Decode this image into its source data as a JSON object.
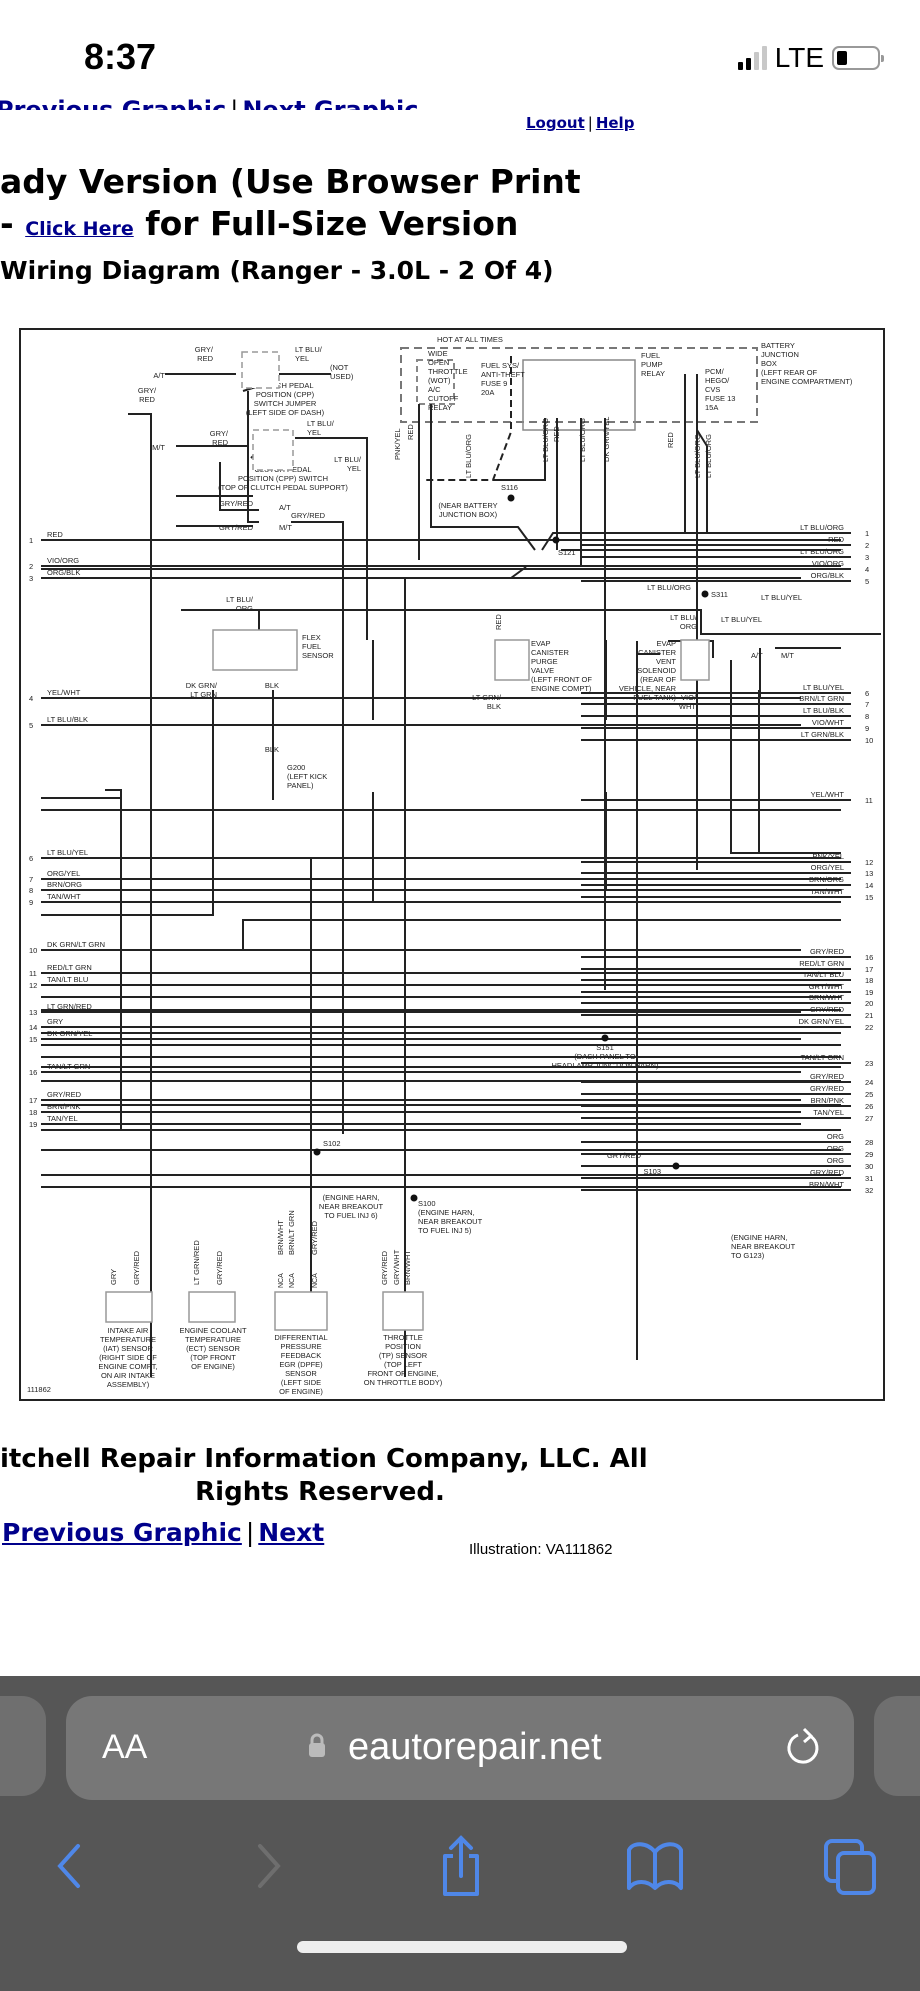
{
  "status_bar": {
    "time": "8:37",
    "network": "LTE",
    "signal_bars_active": 2,
    "signal_bars_total": 4,
    "battery_level": 0.2
  },
  "page": {
    "nav_top": {
      "previous": "Previous Graphic",
      "separator": "|",
      "next": "Next Graphic"
    },
    "top_links": {
      "logout": "Logout",
      "separator": "|",
      "help": "Help"
    },
    "heading_line1": "ady Version (Use Browser Print",
    "heading_line2_prefix": "- ",
    "heading_link": "Click Here",
    "heading_line2_suffix": " for Full-Size Version",
    "subheading": "Wiring Diagram (Ranger - 3.0L - 2 Of 4)",
    "copyright_line1": "itchell Repair Information Company, LLC.  All",
    "copyright_line2": "Rights Reserved.",
    "nav_bottom": {
      "previous": "Previous Graphic",
      "separator": "|",
      "next": "Next"
    },
    "illustration": "Illustration: VA111862"
  },
  "diagram": {
    "id_label": "111862",
    "hot_label": "HOT AT ALL TIMES",
    "components": {
      "cpp_jumper": [
        "CLUTCH PEDAL",
        "POSITION (CPP)",
        "SWITCH JUMPER",
        "(LEFT SIDE OF DASH)"
      ],
      "cpp_switch": [
        "CLUTCH PEDAL",
        "POSITION (CPP) SWITCH",
        "(TOP OF CLUTCH PEDAL SUPPORT)"
      ],
      "wot_relay": [
        "WIDE",
        "OPEN",
        "THROTTLE",
        "(WOT)",
        "A/C",
        "CUTOFF",
        "RELAY"
      ],
      "fuse9": [
        "FUEL SYS/",
        "ANTI-THEFT",
        "FUSE 9",
        "20A"
      ],
      "fuel_pump_relay": [
        "FUEL",
        "PUMP",
        "RELAY"
      ],
      "fuse13": [
        "PCM/",
        "HEGO/",
        "CVS",
        "FUSE 13",
        "15A"
      ],
      "bjb": [
        "BATTERY",
        "JUNCTION",
        "BOX",
        "(LEFT REAR OF",
        "ENGINE COMPARTMENT)"
      ],
      "flex_fuel": [
        "FLEX",
        "FUEL",
        "SENSOR"
      ],
      "evap_purge": [
        "EVAP",
        "CANISTER",
        "PURGE",
        "VALVE",
        "(LEFT FRONT OF",
        "ENGINE COMPT)"
      ],
      "evap_vent": [
        "EVAP",
        "CANISTER",
        "VENT",
        "SOLENOID",
        "(REAR OF",
        "VEHICLE, NEAR",
        "FUEL TANK)"
      ],
      "g200": [
        "G200",
        "(LEFT KICK",
        "PANEL)"
      ],
      "s116": "S116",
      "s121": "S121",
      "s121_note": [
        "(NEAR BATTERY",
        "JUNCTION BOX)"
      ],
      "s311": "S311",
      "s151": [
        "S151",
        "(DASH PANEL TO",
        "HEADLAMP JUNCTION HARN)"
      ],
      "s102": "S102",
      "s102_note": [
        "(ENGINE HARN,",
        "NEAR BREAKOUT",
        "TO FUEL INJ 6)"
      ],
      "s100": [
        "S100",
        "(ENGINE HARN,",
        "NEAR BREAKOUT",
        "TO FUEL INJ 5)"
      ],
      "s103": "S103",
      "s103_note": [
        "(ENGINE HARN,",
        "NEAR BREAKOUT",
        "TO G123)"
      ],
      "iat": [
        "INTAKE AIR",
        "TEMPERATURE",
        "(IAT) SENSOR",
        "(RIGHT SIDE OF",
        "ENGINE COMPT,",
        "ON AIR INTAKE",
        "ASSEMBLY)"
      ],
      "ect": [
        "ENGINE COOLANT",
        "TEMPERATURE",
        "(ECT) SENSOR",
        "(TOP FRONT",
        "OF ENGINE)"
      ],
      "dpfe": [
        "DIFFERENTIAL",
        "PRESSURE",
        "FEEDBACK",
        "EGR (DPFE)",
        "SENSOR",
        "(LEFT SIDE",
        "OF ENGINE)"
      ],
      "tp": [
        "THROTTLE",
        "POSITION",
        "(TP) SENSOR",
        "(TOP LEFT",
        "FRONT OF ENGINE,",
        "ON THROTTLE BODY)"
      ]
    },
    "left_pins": [
      {
        "n": "1",
        "wire": "RED"
      },
      {
        "n": "2",
        "wire": "VIO/ORG"
      },
      {
        "n": "3",
        "wire": "ORG/BLK"
      },
      {
        "n": "4",
        "wire": "YEL/WHT"
      },
      {
        "n": "5",
        "wire": "LT BLU/BLK"
      },
      {
        "n": "6",
        "wire": "LT BLU/YEL"
      },
      {
        "n": "7",
        "wire": "ORG/YEL"
      },
      {
        "n": "8",
        "wire": "BRN/ORG"
      },
      {
        "n": "9",
        "wire": "TAN/WHT"
      },
      {
        "n": "10",
        "wire": "DK GRN/LT GRN"
      },
      {
        "n": "11",
        "wire": "RED/LT GRN"
      },
      {
        "n": "12",
        "wire": "TAN/LT BLU"
      },
      {
        "n": "13",
        "wire": "LT GRN/RED"
      },
      {
        "n": "14",
        "wire": "GRY"
      },
      {
        "n": "15",
        "wire": "DK GRN/YEL"
      },
      {
        "n": "16",
        "wire": "TAN/LT GRN"
      },
      {
        "n": "17",
        "wire": "GRY/RED"
      },
      {
        "n": "18",
        "wire": "BRN/PNK"
      },
      {
        "n": "19",
        "wire": "TAN/YEL"
      }
    ],
    "right_pins": [
      {
        "n": "1",
        "wire": "LT BLU/ORG"
      },
      {
        "n": "2",
        "wire": "RED"
      },
      {
        "n": "3",
        "wire": "LT BLU/ORG"
      },
      {
        "n": "4",
        "wire": "VIO/ORG"
      },
      {
        "n": "5",
        "wire": "ORG/BLK"
      },
      {
        "n": "6",
        "wire": "LT BLU/YEL"
      },
      {
        "n": "7",
        "wire": "BRN/LT GRN"
      },
      {
        "n": "8",
        "wire": "LT BLU/BLK"
      },
      {
        "n": "9",
        "wire": "VIO/WHT"
      },
      {
        "n": "10",
        "wire": "LT GRN/BLK"
      },
      {
        "n": "11",
        "wire": "YEL/WHT"
      },
      {
        "n": "12",
        "wire": "PNK/YEL"
      },
      {
        "n": "13",
        "wire": "ORG/YEL"
      },
      {
        "n": "14",
        "wire": "BRN/ORG"
      },
      {
        "n": "15",
        "wire": "TAN/WHT"
      },
      {
        "n": "16",
        "wire": "GRY/RED"
      },
      {
        "n": "17",
        "wire": "RED/LT GRN"
      },
      {
        "n": "18",
        "wire": "TAN/LT BLU"
      },
      {
        "n": "19",
        "wire": "GRY/WHT"
      },
      {
        "n": "20",
        "wire": "BRN/WHT"
      },
      {
        "n": "21",
        "wire": "GRY/RED"
      },
      {
        "n": "22",
        "wire": "DK GRN/YEL"
      },
      {
        "n": "23",
        "wire": "TAN/LT GRN"
      },
      {
        "n": "24",
        "wire": "GRY/RED"
      },
      {
        "n": "25",
        "wire": "GRY/RED"
      },
      {
        "n": "26",
        "wire": "BRN/PNK"
      },
      {
        "n": "27",
        "wire": "TAN/YEL"
      },
      {
        "n": "28",
        "wire": "ORG"
      },
      {
        "n": "29",
        "wire": "ORG"
      },
      {
        "n": "30",
        "wire": "ORG"
      },
      {
        "n": "31",
        "wire": "GRY/RED"
      },
      {
        "n": "32",
        "wire": "BRN/WHT"
      }
    ],
    "wire_labels": {
      "gry_red_a": [
        "GRY/",
        "RED"
      ],
      "at": "A/T",
      "mt": "M/T",
      "lt_blu_yel": [
        "LT BLU/",
        "YEL"
      ],
      "not_used": [
        "(NOT",
        "USED)"
      ],
      "gry_red": "GRY/RED",
      "pnk_yel": "PNK/YEL",
      "red": "RED",
      "lt_blu_org": "LT BLU/ORG",
      "dk_grn_yel": "DK GRN/YEL",
      "lt_blu_org_2": [
        "LT BLU/",
        "ORG"
      ],
      "dk_grn_lt_grn": [
        "DK GRN/",
        "LT GRN"
      ],
      "blk": "BLK",
      "lt_grn_blk": [
        "LT GRN/",
        "BLK"
      ],
      "vio_wht": [
        "VIO/",
        "WHT"
      ],
      "lt_blu_yel_1": "LT BLU/YEL",
      "gry": "GRY",
      "lt_grn_red": "LT GRN/RED",
      "brn_wht": "BRN/WHT",
      "brn_lt_grn": "BRN/LT GRN",
      "gry_wht": "GRY/WHT",
      "nca": "NCA",
      "pin1": "1",
      "pin2": "2",
      "pin5": "5",
      "pin6": "6"
    }
  },
  "browser": {
    "text_size_button": "AA",
    "url": "eautorepair.net",
    "colors": {
      "toolbar_bg": "#565656",
      "urlbar_bg": "#777777",
      "accent": "#4f87e8"
    }
  }
}
